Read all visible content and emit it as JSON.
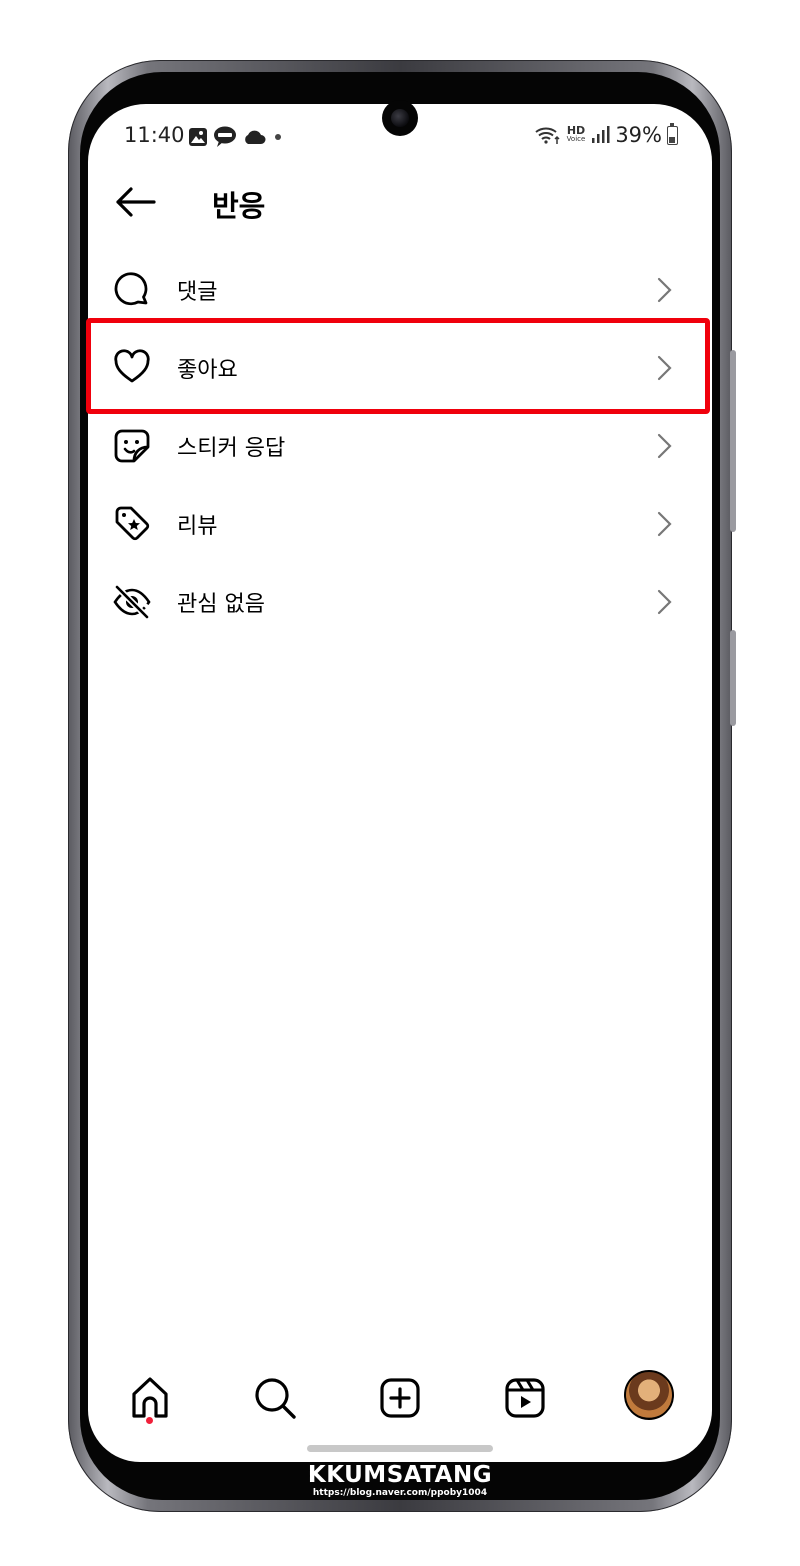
{
  "status_bar": {
    "time": "11:40",
    "battery": "39%",
    "hd": "HD",
    "hd_sub": "Voice"
  },
  "header": {
    "title": "반응",
    "back_icon": "arrow-left-icon"
  },
  "menu": [
    {
      "label": "댓글",
      "icon": "comment-icon"
    },
    {
      "label": "좋아요",
      "icon": "heart-icon"
    },
    {
      "label": "스티커 응답",
      "icon": "sticker-icon"
    },
    {
      "label": "리뷰",
      "icon": "review-tag-icon"
    },
    {
      "label": "관심 없음",
      "icon": "eye-off-icon"
    }
  ],
  "nav": {
    "items": [
      "home-icon",
      "search-icon",
      "create-icon",
      "reels-icon",
      "profile-avatar"
    ]
  },
  "colors": {
    "highlight": "#f0000c",
    "notification_dot": "#f0203a"
  },
  "watermark": {
    "title": "KKUMSATANG",
    "url": "https://blog.naver.com/ppoby1004"
  }
}
